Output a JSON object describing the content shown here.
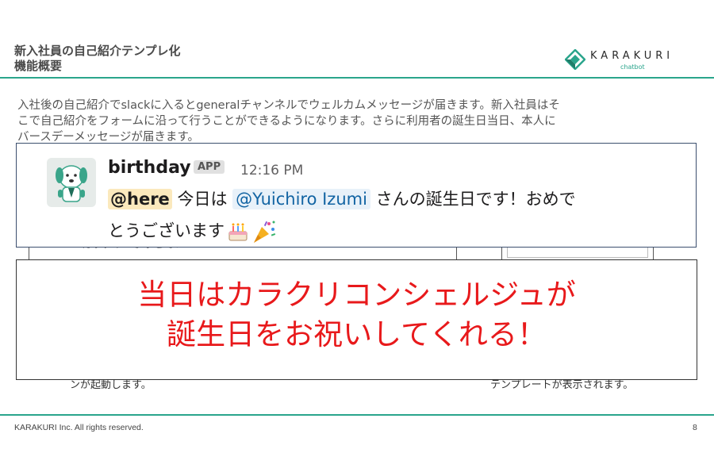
{
  "slide": {
    "title_line1": "新入社員の自己紹介テンプレ化",
    "title_line2": "機能概要",
    "intro_lines": [
      "入社後の自己紹介でslackに入るとgeneralチャンネルでウェルカムメッセージが届きます。新入社員はそ",
      "こで自己紹介をフォームに沿って行うことができるようになります。さらに利用者の誕生日当日、本人に",
      "バースデーメッセージが届きます。"
    ],
    "bg_text_left": "カラクリへようこそ！",
    "bg_caption_left": "ンが起動します。",
    "bg_caption_right": "テンプレートが表示されます。",
    "footer": "KARAKURI Inc. All rights reserved.",
    "page_number": "8"
  },
  "logo": {
    "word": "KARAKURI",
    "sub": "chatbot",
    "color": "#2aa58c"
  },
  "slack_message": {
    "bot_name": "birthday",
    "badge": "APP",
    "time": "12:16 PM",
    "line1_before": "",
    "here_mention": "@here",
    "line1_mid": " 今日は ",
    "user_mention": "@Yuichiro Izumi",
    "line1_after": " さんの誕生日です！おめで",
    "line2": "とうございます",
    "emojis": [
      "birthday-cake",
      "party-popper"
    ]
  },
  "callout": {
    "line1": "当日はカラクリコンシェルジュが",
    "line2": "誕生日をお祝いしてくれる！",
    "color": "#e8191b"
  }
}
